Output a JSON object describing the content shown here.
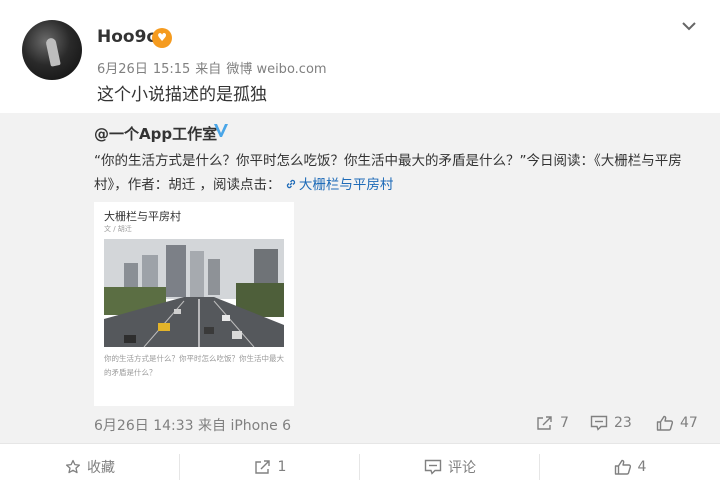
{
  "user": {
    "name": "Hoo9o",
    "badge_icon": "fan-badge-icon"
  },
  "meta": {
    "date": "6月26日",
    "time": "15:15",
    "from": "来自",
    "source": "微博 weibo.com"
  },
  "post_text": "这个小说描述的是孤独",
  "repost": {
    "author": "@一个App工作室",
    "text": "“你的生活方式是什么？你平时怎么吃饭？你生活中最大的矛盾是什么？”今日阅读：《大栅栏与平房村》，作者：胡迁 ，阅读点击：",
    "link_text": "大栅栏与平房村",
    "card": {
      "title": "大栅栏与平房村",
      "author": "文 / 胡迁",
      "caption": "你的生活方式是什么？你平时怎么吃饭？你生活中最大的矛盾是什么？"
    },
    "footer": {
      "date": "6月26日",
      "time": "14:33",
      "from": "来自",
      "device": "iPhone 6"
    },
    "stats": {
      "reposts": "7",
      "comments": "23",
      "likes": "47"
    }
  },
  "actions": {
    "favorite": "收藏",
    "repost": "1",
    "comment": "评论",
    "like": "4"
  },
  "colors": {
    "link": "#1e6bb8",
    "badge": "#f59b1f",
    "verified": "#4aa6e8",
    "muted": "#808080",
    "repost_bg": "#f2f2f2"
  }
}
